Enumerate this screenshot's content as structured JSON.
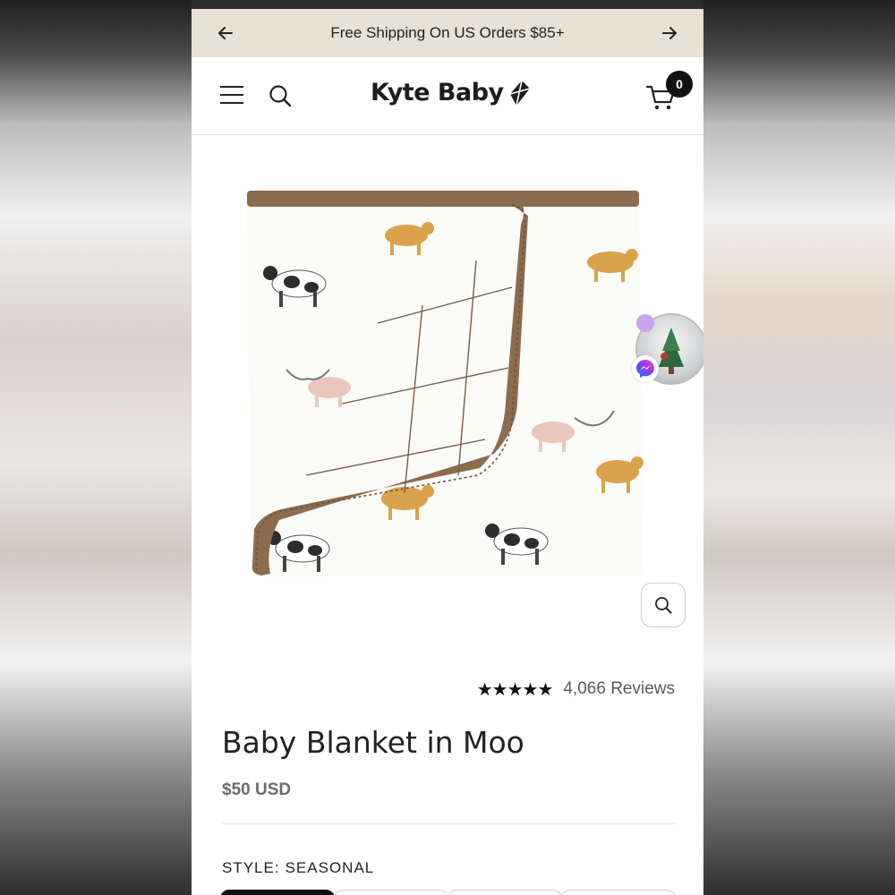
{
  "announcement": {
    "text": "Free Shipping On US Orders $85+",
    "prev_icon": "arrow-left-icon",
    "next_icon": "arrow-right-icon"
  },
  "header": {
    "brand": "Kyte Baby",
    "menu_icon": "hamburger-icon",
    "search_icon": "search-icon",
    "cart_icon": "cart-icon",
    "cart_count": "0"
  },
  "product": {
    "rating_stars": "★★★★★",
    "reviews": "4,066 Reviews",
    "title": "Baby Blanket in Moo",
    "price": "$50 USD",
    "style_label": "STYLE:",
    "style_value": "SEASONAL",
    "zoom_icon": "magnifier-icon"
  },
  "chat_widget": {
    "icon": "messenger-icon"
  },
  "colors": {
    "announcement_bg": "#e6e2d6",
    "blanket_brown": "#8b6c4f",
    "text_dark": "#222222"
  }
}
